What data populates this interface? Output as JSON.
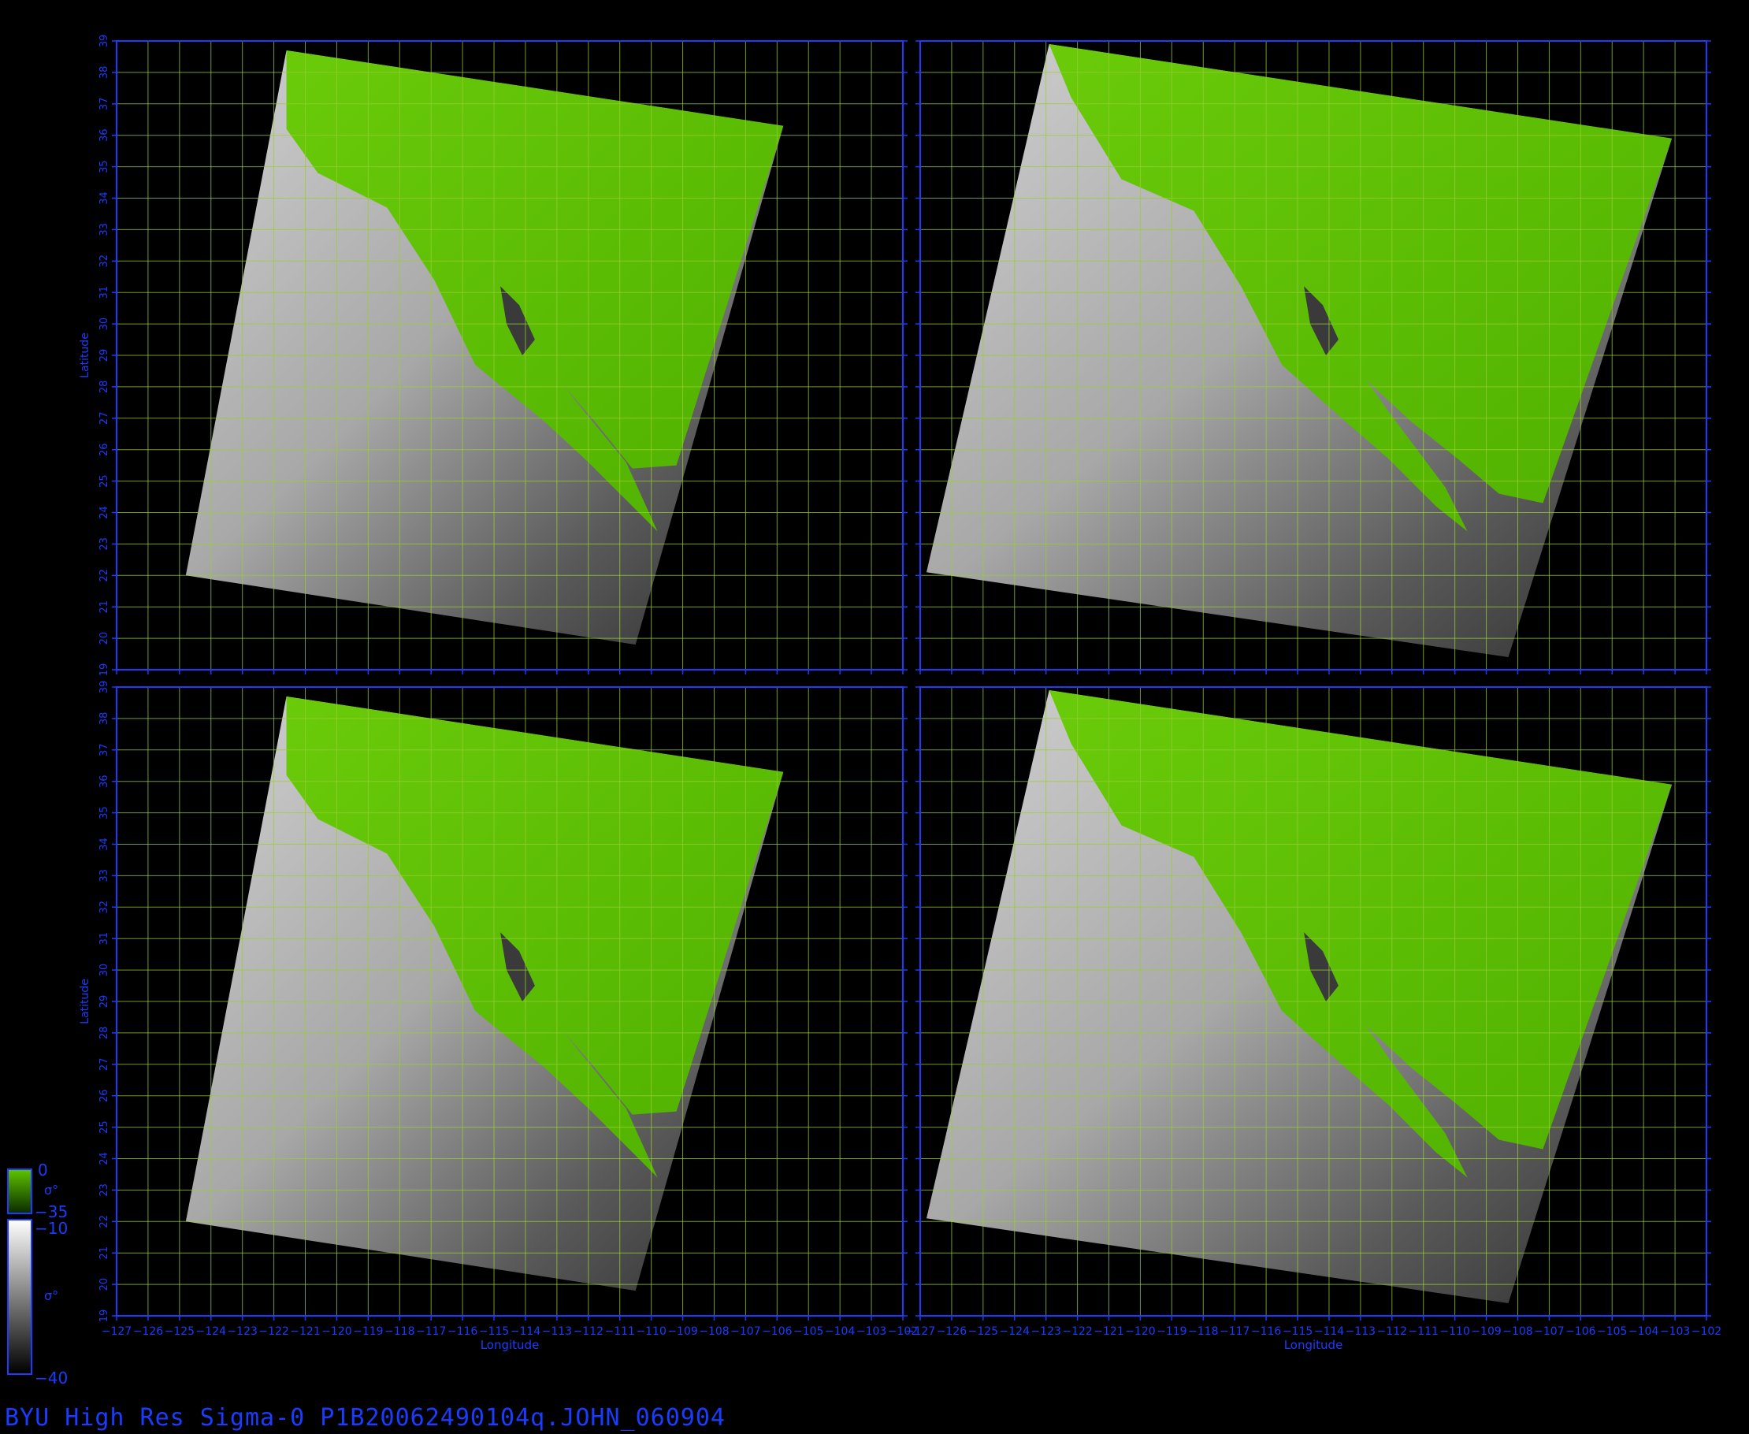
{
  "caption": "BYU High Res Sigma-0 P1B20062490104q.JOHN_060904",
  "axes": {
    "xlabel": "Longitude",
    "ylabel": "Latitude",
    "lon_ticks": [
      -127,
      -126,
      -125,
      -124,
      -123,
      -122,
      -121,
      -120,
      -119,
      -118,
      -117,
      -116,
      -115,
      -114,
      -113,
      -112,
      -111,
      -110,
      -109,
      -108,
      -107,
      -106,
      -105,
      -104,
      -103,
      -102
    ],
    "lat_ticks": [
      19,
      20,
      21,
      22,
      23,
      24,
      25,
      26,
      27,
      28,
      29,
      30,
      31,
      32,
      33,
      34,
      35,
      36,
      37,
      38,
      39
    ],
    "lon_range": [
      -127,
      -102
    ],
    "lat_range": [
      19,
      39
    ],
    "grid_color": "#9acd32",
    "axis_color": "#1a3cff"
  },
  "legend": {
    "land_top": "0",
    "land_symbol": "σ°",
    "land_bottom": "−35",
    "ocean_top": "−10",
    "ocean_symbol": "σ°",
    "ocean_bottom": "−40",
    "land_color": "#5fc400",
    "ocean_color_high": "#ffffff",
    "ocean_color_low": "#000000"
  },
  "panels": [
    {
      "id": "panel-top-left"
    },
    {
      "id": "panel-top-right"
    },
    {
      "id": "panel-bottom-left"
    },
    {
      "id": "panel-bottom-right"
    }
  ]
}
